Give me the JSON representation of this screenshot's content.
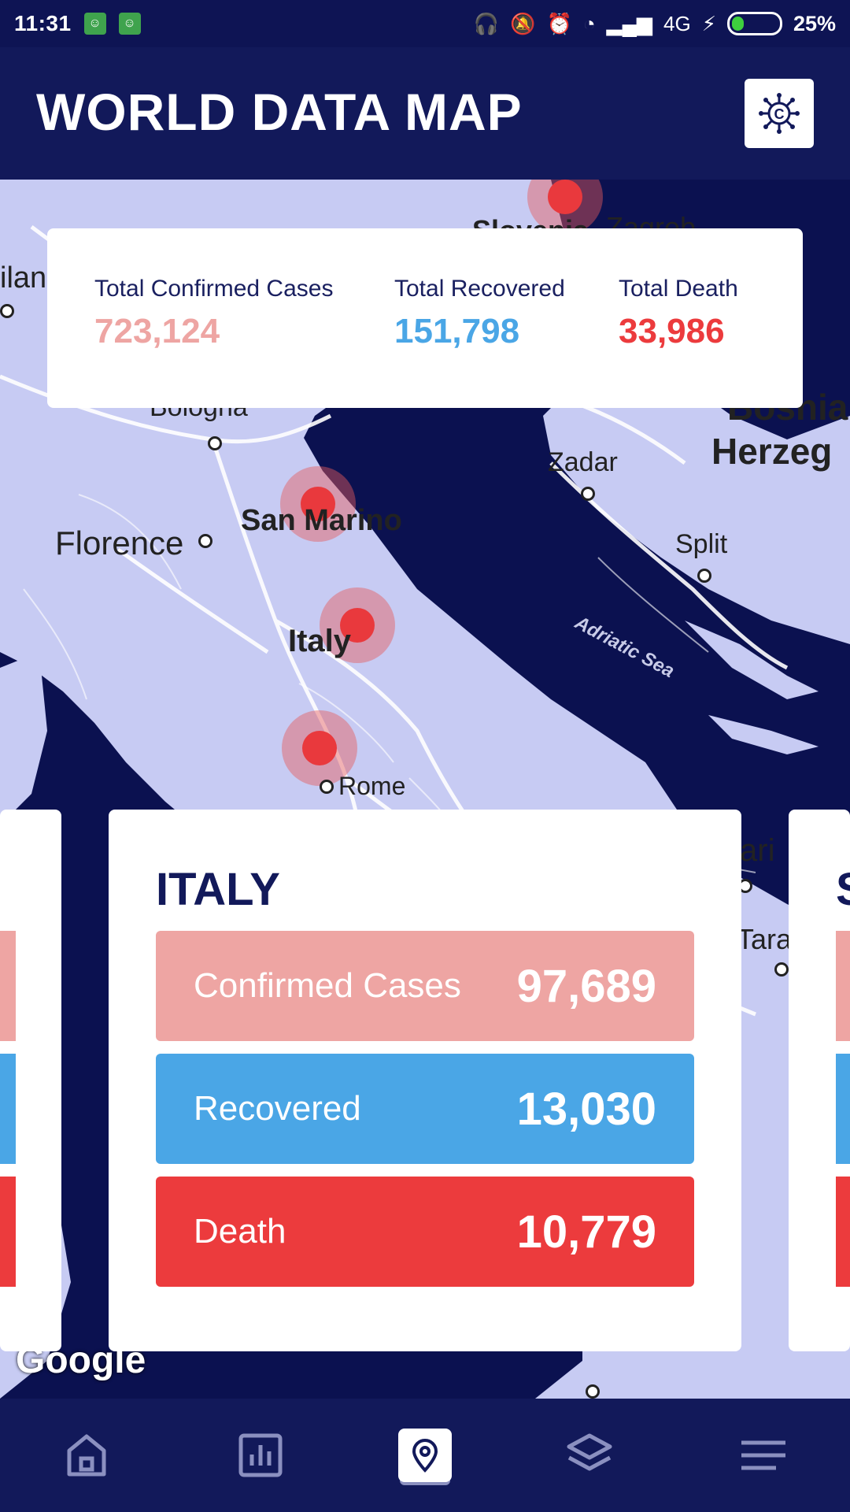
{
  "status_bar": {
    "time": "11:31",
    "network": "4G",
    "battery_percent": "25%",
    "battery_level": 0.25
  },
  "header": {
    "title": "WORLD DATA MAP",
    "action_icon": "virus-icon"
  },
  "summary": {
    "confirmed_label": "Total Confirmed Cases",
    "confirmed_value": "723,124",
    "recovered_label": "Total Recovered",
    "recovered_value": "151,798",
    "death_label": "Total Death",
    "death_value": "33,986"
  },
  "map": {
    "labels": {
      "milan": "ilan",
      "zagreb": "Zagreb",
      "slovenia": "Slovenia",
      "bologna": "Bologna",
      "bosnia1": "Bosnia",
      "bosnia2": "Herzeg",
      "zadar": "Zadar",
      "san_marino": "San Marino",
      "florence": "Florence",
      "split": "Split",
      "italy": "Italy",
      "adriatic": "Adriatic Sea",
      "rome": "Rome",
      "bari": "ari",
      "taranto": "Tara",
      "google": "Google"
    }
  },
  "country_card": {
    "name": "ITALY",
    "confirmed_label": "Confirmed Cases",
    "confirmed_value": "97,689",
    "recovered_label": "Recovered",
    "recovered_value": "13,030",
    "death_label": "Death",
    "death_value": "10,779"
  },
  "next_card_initial": "S",
  "colors": {
    "navy": "#12195a",
    "confirmed": "#eea5a3",
    "recovered": "#4aa6e6",
    "death": "#ec3b3d"
  },
  "bottom_nav": [
    {
      "icon": "home-icon",
      "active": false
    },
    {
      "icon": "bar-chart-icon",
      "active": false
    },
    {
      "icon": "map-pin-icon",
      "active": true
    },
    {
      "icon": "layers-icon",
      "active": false
    },
    {
      "icon": "menu-icon",
      "active": false
    }
  ]
}
